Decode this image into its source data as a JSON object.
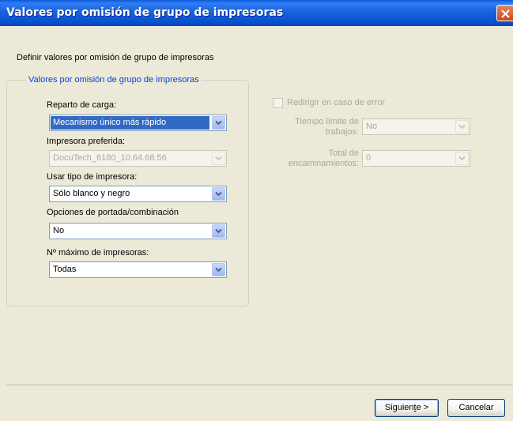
{
  "window": {
    "title": "Valores por omisión de grupo de impresoras",
    "close_icon": "close-icon"
  },
  "heading": "Definir valores por omisión de grupo de impresoras",
  "group": {
    "legend": "Valores por omisión de grupo de impresoras",
    "load_sharing": {
      "label": "Reparto de carga:",
      "value": "Mecanismo único más rápido"
    },
    "preferred_printer": {
      "label": "Impresora preferida:",
      "value": "DocuTech_6180_10.64.68.56",
      "enabled": false
    },
    "printer_type": {
      "label": "Usar tipo de impresora:",
      "value": "Sólo blanco y negro"
    },
    "cover_options": {
      "label": "Opciones de portada/combinación",
      "value": "No"
    },
    "max_printers": {
      "label": "Nº máximo de impresoras:",
      "value": "Todas"
    }
  },
  "redirect": {
    "checkbox_label": "Redirigir en caso de error",
    "checked": false,
    "enabled": false,
    "timeout": {
      "label_line1": "Tiempo límite de",
      "label_line2": "trabajos:",
      "value": "No"
    },
    "routings": {
      "label_line1": "Total de",
      "label_line2": "encaminamientos:",
      "value": "0"
    }
  },
  "buttons": {
    "next_pre": "Siguien",
    "next_mnemonic": "t",
    "next_post": "e >",
    "cancel": "Cancelar"
  },
  "colors": {
    "titlebar": "#0a52cf",
    "dialog_bg": "#ece9d8",
    "selection": "#316ac5",
    "legend_text": "#0046d5",
    "disabled_text": "#aca899"
  }
}
